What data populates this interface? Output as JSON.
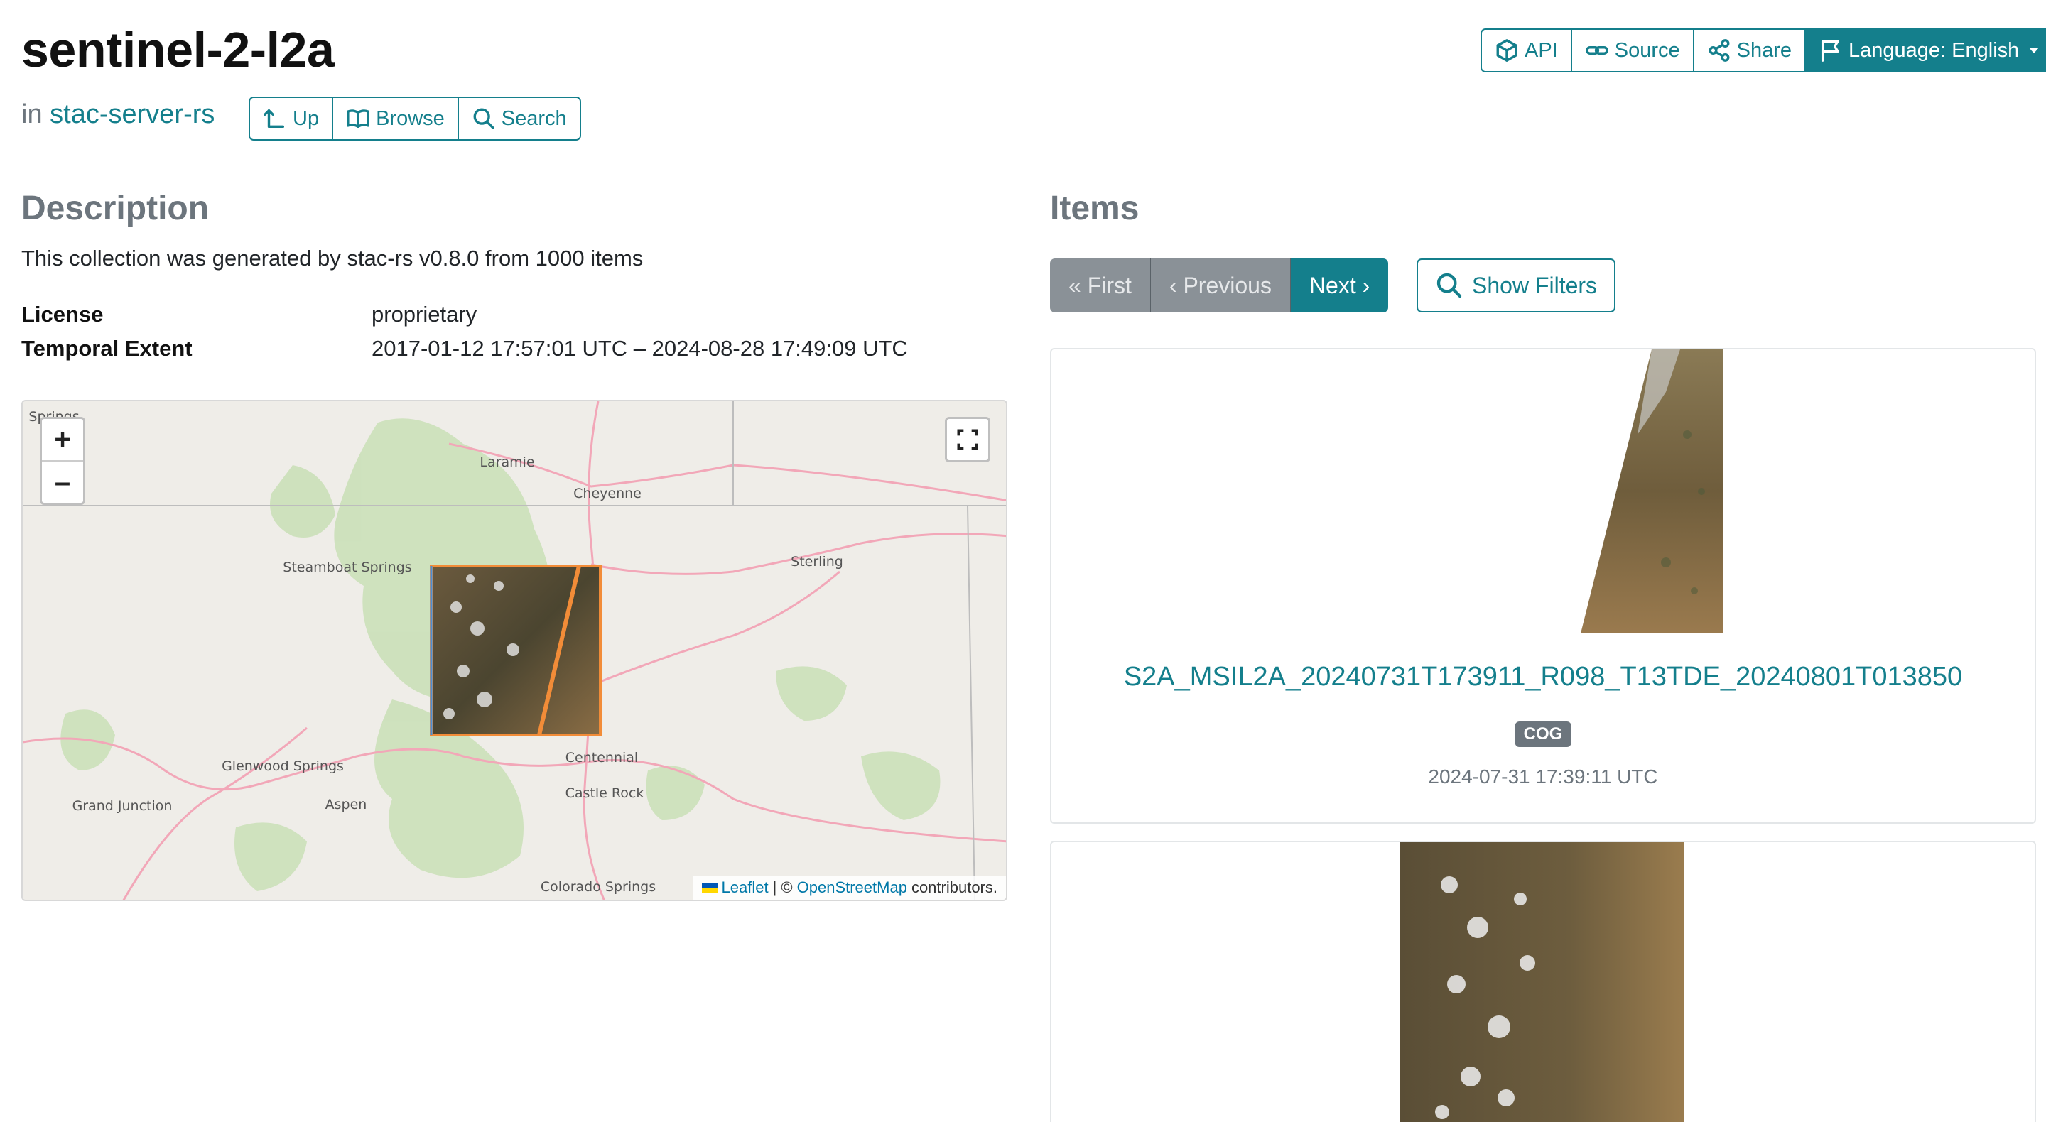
{
  "page": {
    "title": "sentinel-2-l2a",
    "in_prefix": "in",
    "parent_link": "stac-server-rs"
  },
  "nav_buttons": [
    {
      "label": "Up",
      "icon": "arrow-up-icon"
    },
    {
      "label": "Browse",
      "icon": "book-icon"
    },
    {
      "label": "Search",
      "icon": "search-icon"
    }
  ],
  "top_buttons": [
    {
      "label": "API",
      "icon": "cube-icon"
    },
    {
      "label": "Source",
      "icon": "link-icon"
    },
    {
      "label": "Share",
      "icon": "share-icon"
    },
    {
      "label": "Language: English",
      "icon": "flag-icon"
    }
  ],
  "description": {
    "heading": "Description",
    "text": "This collection was generated by stac-rs v0.8.0 from 1000 items",
    "license_label": "License",
    "license_value": "proprietary",
    "temporal_label": "Temporal Extent",
    "temporal_value": "2017-01-12 17:57:01 UTC – 2024-08-28 17:49:09 UTC"
  },
  "map": {
    "zoom_in": "+",
    "zoom_out": "–",
    "cities": [
      "Springs",
      "Laramie",
      "Cheyenne",
      "Steamboat Springs",
      "Sterling",
      "Glenwood Springs",
      "Aspen",
      "Grand Junction",
      "Centennial",
      "Castle Rock",
      "Colorado Springs"
    ],
    "attribution_leaflet": "Leaflet",
    "attribution_sep": "| ©",
    "attribution_osm": "OpenStreetMap",
    "attribution_suffix": "contributors.",
    "footprint_color": "#f28c38"
  },
  "items": {
    "heading": "Items",
    "pager": {
      "first": "« First",
      "previous": "‹ Previous",
      "next": "Next ›"
    },
    "show_filters": "Show Filters",
    "list": [
      {
        "title": "S2A_MSIL2A_20240731T173911_R098_T13TDE_20240801T013850",
        "badge": "COG",
        "datetime": "2024-07-31 17:39:11 UTC"
      }
    ]
  },
  "colors": {
    "accent": "#147f8c",
    "disabled": "#8a9197"
  }
}
